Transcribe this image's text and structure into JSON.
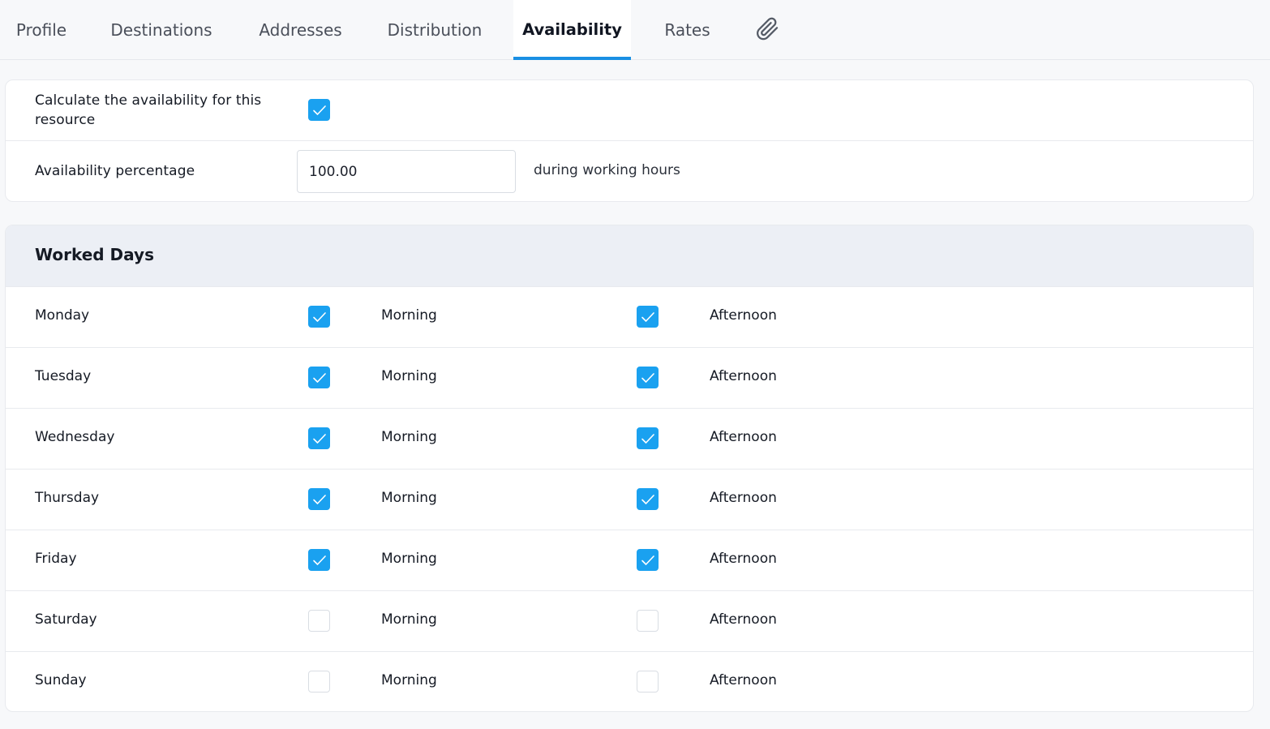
{
  "tabs": [
    {
      "label": "Profile",
      "active": false
    },
    {
      "label": "Destinations",
      "active": false
    },
    {
      "label": "Addresses",
      "active": false
    },
    {
      "label": "Distribution",
      "active": false
    },
    {
      "label": "Availability",
      "active": true
    },
    {
      "label": "Rates",
      "active": false
    }
  ],
  "attachment_icon": "paperclip-icon",
  "settings": {
    "calculate_label": "Calculate the availability for this resource",
    "calculate_checked": true,
    "percentage_label": "Availability percentage",
    "percentage_value": "100.00",
    "percentage_suffix": "during working hours"
  },
  "worked_days": {
    "title": "Worked Days",
    "morning_label": "Morning",
    "afternoon_label": "Afternoon",
    "days": [
      {
        "name": "Monday",
        "morning": true,
        "afternoon": true
      },
      {
        "name": "Tuesday",
        "morning": true,
        "afternoon": true
      },
      {
        "name": "Wednesday",
        "morning": true,
        "afternoon": true
      },
      {
        "name": "Thursday",
        "morning": true,
        "afternoon": true
      },
      {
        "name": "Friday",
        "morning": true,
        "afternoon": true
      },
      {
        "name": "Saturday",
        "morning": false,
        "afternoon": false
      },
      {
        "name": "Sunday",
        "morning": false,
        "afternoon": false
      }
    ]
  },
  "colors": {
    "accent": "#1a8fe3",
    "checkbox_on": "#1aa1f0",
    "header_bg": "#eceff5"
  }
}
